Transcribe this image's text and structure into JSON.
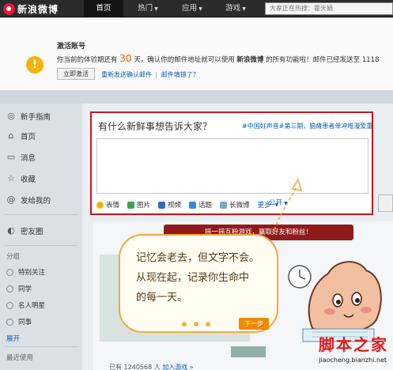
{
  "app": {
    "logo_text": "新浪微博",
    "nav": [
      {
        "label": "首页"
      },
      {
        "label": "热门"
      },
      {
        "label": "应用"
      },
      {
        "label": "游戏"
      }
    ],
    "search_placeholder": "大家正在热搜：霍天娟"
  },
  "notice": {
    "title": "激活账号",
    "text_before": "你当前的体验期还有",
    "days": "30",
    "text_middle": "天，确认你的邮件地址就可以使用",
    "brand": "新浪微博",
    "text_after": "的所有功能啦！邮件已经发送至 1118",
    "activate_button": "立即激活",
    "resend_link": "重新发送确认邮件",
    "wrong_email_link": "邮件填错了？",
    "separator": "|"
  },
  "sidebar": {
    "items": [
      {
        "label": "新手指南",
        "icon": "compass-icon"
      },
      {
        "label": "首页",
        "icon": "home-icon"
      },
      {
        "label": "消息",
        "icon": "message-icon"
      },
      {
        "label": "收藏",
        "icon": "star-icon"
      },
      {
        "label": "发给我的",
        "icon": "at-icon"
      },
      {
        "label": "密友圈",
        "icon": "friends-icon"
      }
    ],
    "group_title": "分组",
    "groups": [
      {
        "label": "特别关注"
      },
      {
        "label": "同学"
      },
      {
        "label": "名人明星"
      },
      {
        "label": "同事"
      }
    ],
    "expand_link": "展开",
    "recent_title": "最近使用"
  },
  "composer": {
    "prompt": "有什么新鲜事想告诉大家？",
    "topic": "#中国好声音#第三期，脑瘫患者单冲唯漫爱重生",
    "tools": [
      {
        "label": "表情",
        "icon": "smile-icon",
        "color": "#f0b400"
      },
      {
        "label": "图片",
        "icon": "image-icon",
        "color": "#3aa655"
      },
      {
        "label": "视频",
        "icon": "video-icon",
        "color": "#2f6fbe"
      },
      {
        "label": "话题",
        "icon": "topic-icon",
        "color": "#2f8fd6"
      },
      {
        "label": "长微博",
        "icon": "longpost-icon",
        "color": "#7aa7cf"
      }
    ],
    "more": "更多",
    "visibility": "公开"
  },
  "background": {
    "banner_text": "摇一摇互粉游戏，赢取好友和粉丝！",
    "footer_prefix": "已有",
    "footer_count": "1240568",
    "footer_middle": "人",
    "footer_link": "加入游戏",
    "footer_suffix": "»"
  },
  "tip": {
    "text_lines": [
      "记忆会老去，但文字不会。",
      "从现在起，记录你生命中",
      "的每一天。"
    ],
    "next_button": "下一步",
    "page_dots": 3
  },
  "watermark": {
    "line1": "脚本之家",
    "line2": "jiaocheng.bianzhi.net"
  },
  "colors": {
    "highlight_border": "#c8161d",
    "accent_orange": "#f08a00",
    "link_blue": "#0a5fb3",
    "nav_bg": "#2b2b2b"
  }
}
